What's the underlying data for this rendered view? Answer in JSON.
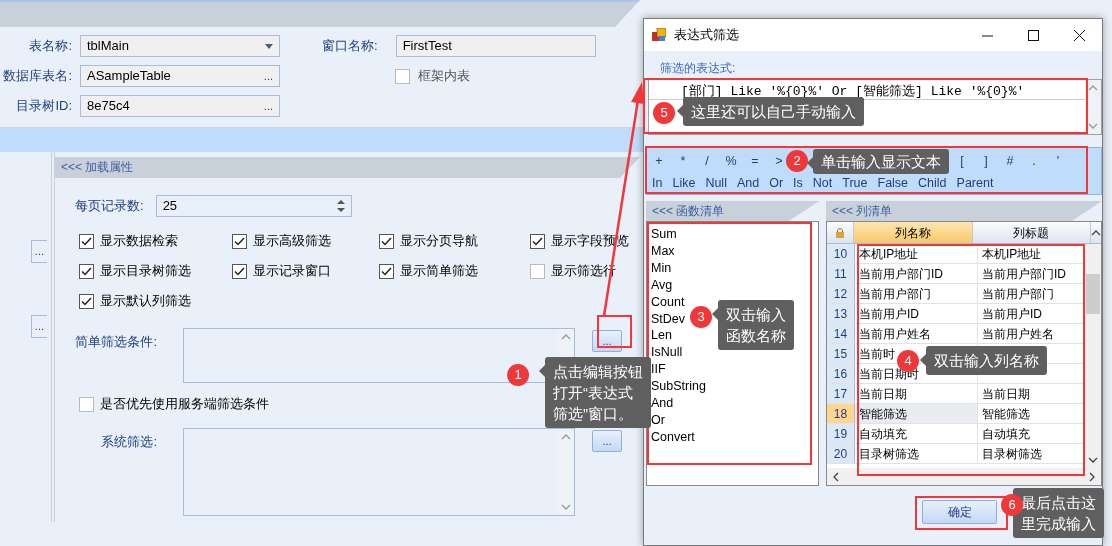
{
  "main_form": {
    "fields": [
      {
        "label": "表名称:",
        "value": "tblMain",
        "kind": "dropdown"
      },
      {
        "label": "数据库表名:",
        "value": "ASampleTable",
        "kind": "picker",
        "button": "..."
      },
      {
        "label": "目录树ID:",
        "value": "8e75c4",
        "kind": "picker",
        "button": "..."
      }
    ],
    "window_name": {
      "label": "窗口名称:",
      "value": "FirstTest"
    },
    "frame_table": {
      "label": "框架内表",
      "checked": false
    }
  },
  "side_panel": {
    "buttons": [
      "...",
      "..."
    ]
  },
  "load_section": {
    "title": "<<< 加载属性",
    "page_size": {
      "label": "每页记录数:",
      "value": "25"
    },
    "options": [
      {
        "label": "显示数据检索",
        "checked": true
      },
      {
        "label": "显示高级筛选",
        "checked": true
      },
      {
        "label": "显示分页导航",
        "checked": true
      },
      {
        "label": "显示字段预览",
        "checked": true
      },
      {
        "label": "显示目录树筛选",
        "checked": true
      },
      {
        "label": "显示记录窗口",
        "checked": true
      },
      {
        "label": "显示简单筛选",
        "checked": true
      },
      {
        "label": "显示筛选行",
        "checked": false
      },
      {
        "label": "显示默认列筛选",
        "checked": true
      }
    ],
    "simple_filter": {
      "label": "简单筛选条件:",
      "button": "..."
    },
    "server_first": {
      "label": "是否优先使用服务端筛选条件",
      "checked": false
    },
    "system_filter": {
      "label": "系统筛选:",
      "button": "..."
    }
  },
  "dialog": {
    "title": "表达式筛选",
    "expression_label": "筛选的表达式:",
    "expression": "[部门] Like '%{0}%' Or [智能筛选] Like '%{0}%'",
    "operators": [
      "+",
      "*",
      "/",
      "%",
      "=",
      ">"
    ],
    "more_operators": [
      "[",
      "]",
      "#",
      ".",
      "'"
    ],
    "keywords": [
      "In",
      "Like",
      "Null",
      "And",
      "Or",
      "Is",
      "Not",
      "True",
      "False",
      "Child",
      "Parent"
    ],
    "functions_title": "<<< 函数清单",
    "functions": [
      "Sum",
      "Max",
      "Min",
      "Avg",
      "Count",
      "StDev",
      "Len",
      "IsNull",
      "IIF",
      "SubString",
      "And",
      "Or",
      "Convert"
    ],
    "columns_title": "<<< 列清单",
    "grid": {
      "columns": [
        "列名称",
        "列标题"
      ],
      "rows": [
        {
          "number": "10",
          "name": "本机IP地址",
          "title": "本机IP地址",
          "selected": false
        },
        {
          "number": "11",
          "name": "当前用户部门ID",
          "title": "当前用户部门ID",
          "selected": false
        },
        {
          "number": "12",
          "name": "当前用户部门",
          "title": "当前用户部门",
          "selected": false
        },
        {
          "number": "13",
          "name": "当前用户ID",
          "title": "当前用户ID",
          "selected": false
        },
        {
          "number": "14",
          "name": "当前用户姓名",
          "title": "当前用户姓名",
          "selected": false
        },
        {
          "number": "15",
          "name": "当前时",
          "selected": false
        },
        {
          "number": "16",
          "name": "当前日期时",
          "selected": false
        },
        {
          "number": "17",
          "name": "当前日期",
          "title": "当前日期",
          "selected": false
        },
        {
          "number": "18",
          "name": "智能筛选",
          "title": "智能筛选",
          "selected": true
        },
        {
          "number": "19",
          "name": "自动填充",
          "title": "自动填充",
          "selected": false
        },
        {
          "number": "20",
          "name": "目录树筛选",
          "title": "目录树筛选",
          "selected": false
        }
      ]
    },
    "ok_button": "确定"
  },
  "annotations": [
    {
      "number": "1",
      "text": "点击编辑按钮打开“表达式筛选”窗口。"
    },
    {
      "number": "2",
      "text": "单击输入显示文本"
    },
    {
      "number": "3",
      "text": "双击输入函数名称"
    },
    {
      "number": "4",
      "text": "双击输入列名称"
    },
    {
      "number": "5",
      "text": "这里还可以自己手动输入"
    },
    {
      "number": "6",
      "text": "最后点击这里完成输入"
    }
  ]
}
